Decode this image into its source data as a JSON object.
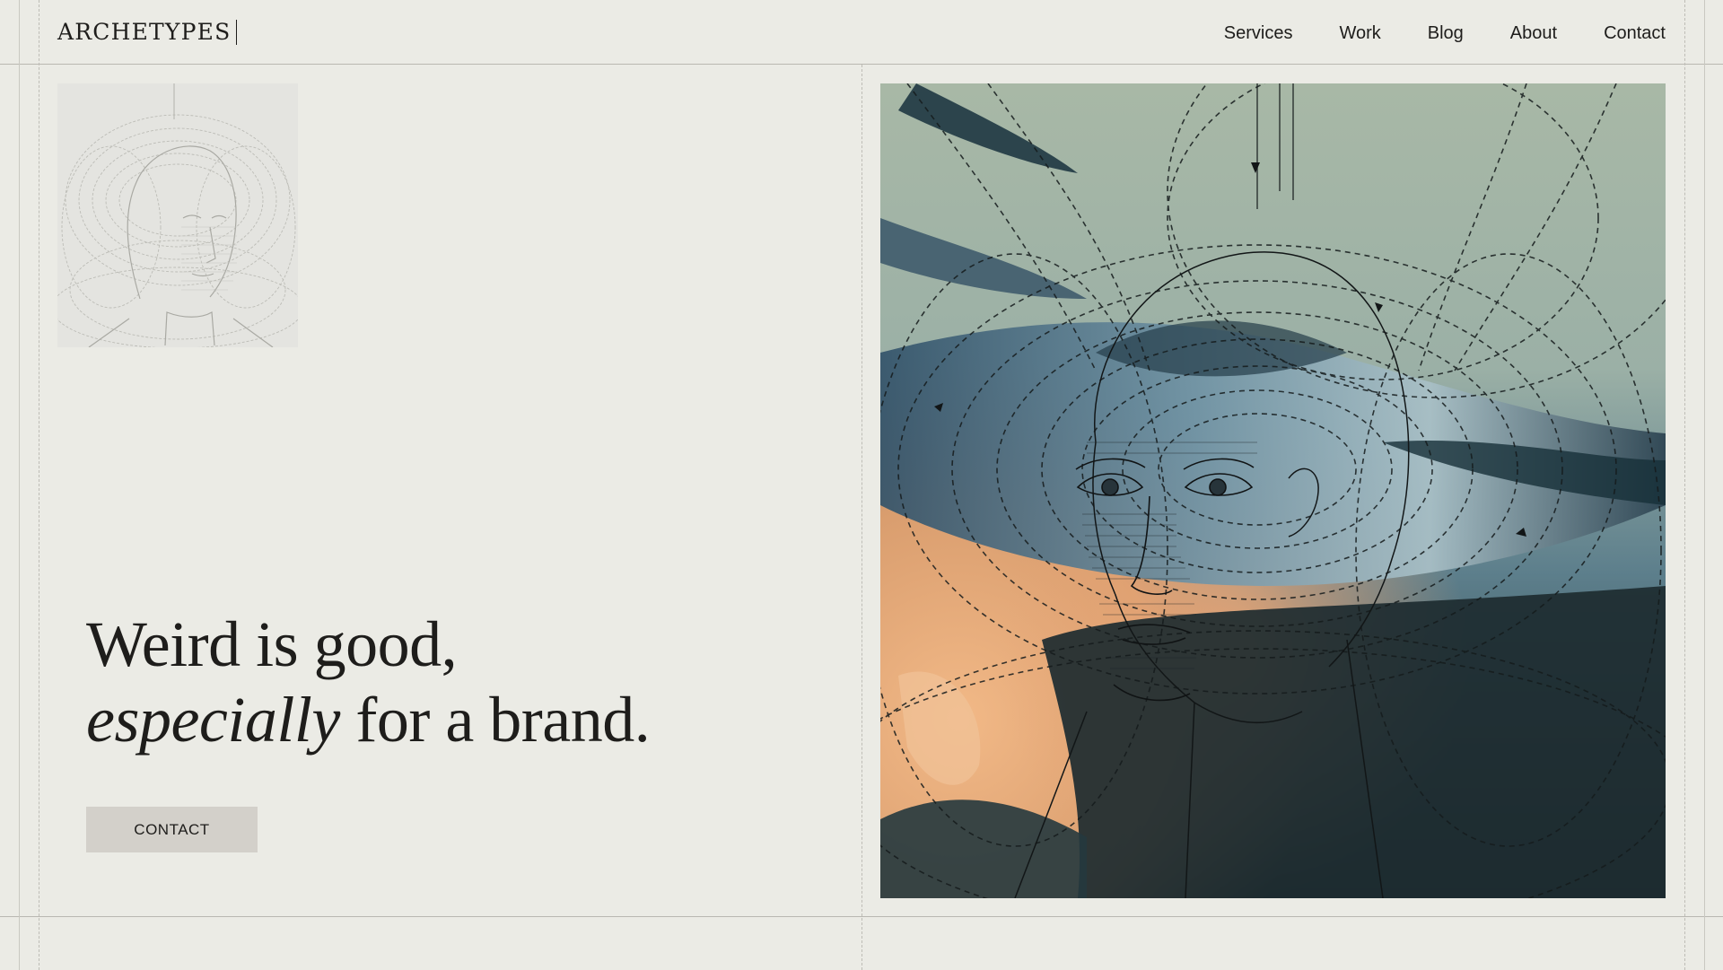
{
  "brand": {
    "logo_text": "ARCHETYPES"
  },
  "nav": {
    "items": [
      {
        "label": "Services"
      },
      {
        "label": "Work"
      },
      {
        "label": "Blog"
      },
      {
        "label": "About"
      },
      {
        "label": "Contact"
      }
    ]
  },
  "hero": {
    "headline_line1": "Weird is good,",
    "headline_line2_italic": "especially",
    "headline_line2_rest": " for a brand.",
    "cta_label": "CONTACT"
  },
  "images": {
    "thumbnail": "faint pencil sketch of a head with magnetic field lines",
    "hero": "collage of an engraved head with dashed field lines over a blue, teal and peach painted background"
  },
  "colors": {
    "background": "#ebebe5",
    "text": "#1e1d1b",
    "button": "#d3d0ca",
    "rule": "#b9b8b1",
    "hero_sage": "#9fb0a0",
    "hero_blue": "#4f7080",
    "hero_dark": "#223236",
    "hero_peach": "#e6ae7b"
  }
}
